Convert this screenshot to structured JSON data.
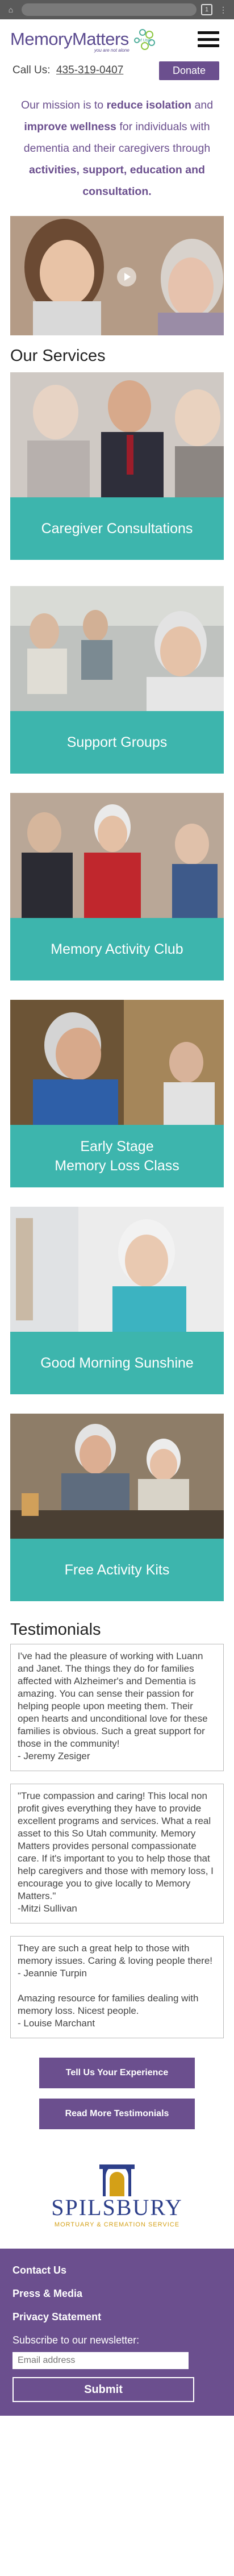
{
  "header": {
    "logo_main": "MemoryMatters",
    "logo_of": "of Utah",
    "logo_tagline": "you are not alone",
    "call_label": "Call Us:",
    "phone": "435-319-0407",
    "donate_label": "Donate"
  },
  "mission": {
    "p1": "Our mission is to ",
    "b1": "reduce isolation",
    "p2": " and ",
    "b2": "improve wellness",
    "p3": " for individuals with dementia and their caregivers through ",
    "b3": "activities, support, education and consultation."
  },
  "services": {
    "title": "Our Services",
    "items": [
      {
        "label": "Caregiver Consultations"
      },
      {
        "label": "Support Groups"
      },
      {
        "label": "Memory Activity Club"
      },
      {
        "label": "Early Stage\nMemory Loss Class"
      },
      {
        "label": "Good Morning Sunshine"
      },
      {
        "label": "Free Activity Kits"
      }
    ]
  },
  "testimonials": {
    "title": "Testimonials",
    "items": [
      {
        "text": "I've had the pleasure of working with Luann and Janet. The things they do for families affected with Alzheimer's and Dementia is amazing. You can sense their passion for helping people upon meeting them. Their open hearts and unconditional love for these families is obvious.  Such a great support for those in the community!\n- Jeremy Zesiger"
      },
      {
        "text": "\"True compassion and caring!  This local non profit gives everything they have to provide excellent programs and services. What a real asset to this So Utah community. Memory Matters provides personal compassionate care. If it's important to you to help those that help caregivers and those with memory loss, I encourage you to give locally to Memory Matters.\"\n-Mitzi Sullivan"
      },
      {
        "text": "They are such a great help to those with memory issues. Caring & loving people there!\n- Jeannie Turpin\n\nAmazing resource for families dealing with memory loss. Nicest people.\n- Louise Marchant"
      }
    ],
    "tell_label": "Tell Us Your Experience",
    "more_label": "Read More Testimonials"
  },
  "sponsor": {
    "name": "SPILSBURY",
    "sub": "MORTUARY & CREMATION SERVICE"
  },
  "footer": {
    "links": [
      "Contact Us",
      "Press & Media",
      "Privacy Statement"
    ],
    "newsletter_label": "Subscribe to our newsletter:",
    "email_placeholder": "Email address",
    "submit_label": "Submit"
  },
  "colors": {
    "brand_purple": "#6b4f8e",
    "teal": "#3db5ad"
  }
}
